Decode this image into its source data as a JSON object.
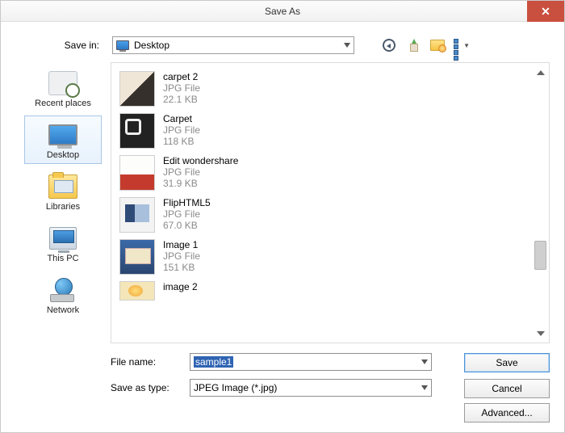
{
  "window": {
    "title": "Save As"
  },
  "topbar": {
    "savein_label": "Save in:",
    "savein_value": "Desktop"
  },
  "places": [
    {
      "key": "recent",
      "label": "Recent places",
      "selected": false
    },
    {
      "key": "desktop",
      "label": "Desktop",
      "selected": true
    },
    {
      "key": "libraries",
      "label": "Libraries",
      "selected": false
    },
    {
      "key": "thispc",
      "label": "This PC",
      "selected": false
    },
    {
      "key": "network",
      "label": "Network",
      "selected": false
    }
  ],
  "files": [
    {
      "name": "carpet 2",
      "type": "JPG File",
      "size": "22.1 KB"
    },
    {
      "name": "Carpet",
      "type": "JPG File",
      "size": "118 KB"
    },
    {
      "name": "Edit wondershare",
      "type": "JPG File",
      "size": "31.9 KB"
    },
    {
      "name": "FlipHTML5",
      "type": "JPG File",
      "size": "67.0 KB"
    },
    {
      "name": "Image 1",
      "type": "JPG File",
      "size": "151 KB"
    },
    {
      "name": "image 2",
      "type": "",
      "size": ""
    }
  ],
  "fields": {
    "filename_label": "File name:",
    "filename_value": "sample1",
    "savetype_label": "Save as type:",
    "savetype_value": "JPEG Image (*.jpg)"
  },
  "buttons": {
    "save": "Save",
    "cancel": "Cancel",
    "advanced": "Advanced..."
  }
}
